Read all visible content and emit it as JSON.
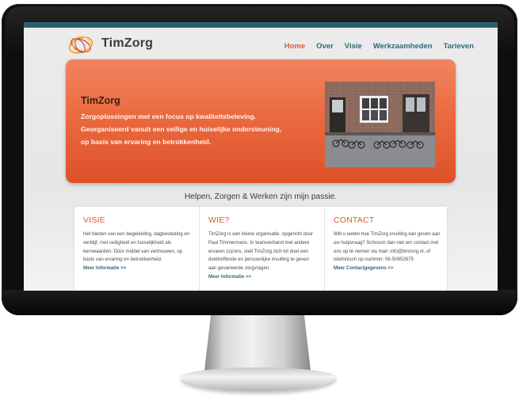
{
  "site": {
    "logo_text": "TimZorg"
  },
  "nav": {
    "items": [
      "Home",
      "Over",
      "Visie",
      "Werkzaamheden",
      "Tarieven"
    ],
    "active": "Home"
  },
  "hero": {
    "title": "TimZorg",
    "lines": [
      "Zorgoplossingen met een focus op kwaliteitsbeleving.",
      "Georganiseerd vanuit een veilige en huiselijke ondersteuning,",
      "op basis van ervaring en betrokkenheid."
    ]
  },
  "tagline": "Helpen, Zorgen & Werken zijn mijn passie.",
  "columns": [
    {
      "title": "VISIE",
      "lines": [
        "Het bieden van een begeleiding, dagbesteding en",
        "verblijf, met veiligheid en huiselijkheid als",
        "kernwaarden. Door middel van vertrouwen, op",
        "basis van ervaring en betrokkenheid."
      ],
      "link": "Meer Informatie >>"
    },
    {
      "title": "WIE?",
      "lines": [
        "TimZorg is een kleine organisatie, opgericht door",
        "Paul Timmermans. In teamverband met andere",
        "ervaren zzp'ers, stelt TimZorg zich tot doel een",
        "doeltreffende en persoonlijke invulling te geven",
        "aan gevarieerde zorgvragen."
      ],
      "link": "Meer Informatie >>"
    },
    {
      "title": "CONTACT",
      "lines": [
        "Wilt u weten hoe TimZorg invulling kan geven aan",
        "uw hulpvraag? Schroom dan niet om contact met",
        "ons op te nemen via mail: info@timzorg.nl, of",
        "telefonisch op nummer: 06-50652675"
      ],
      "link": "Meer Contactgegevens >>"
    }
  ],
  "colors": {
    "accent_orange": "#e05a2b",
    "nav_teal": "#2f6a74",
    "top_bar": "#2c6070"
  }
}
